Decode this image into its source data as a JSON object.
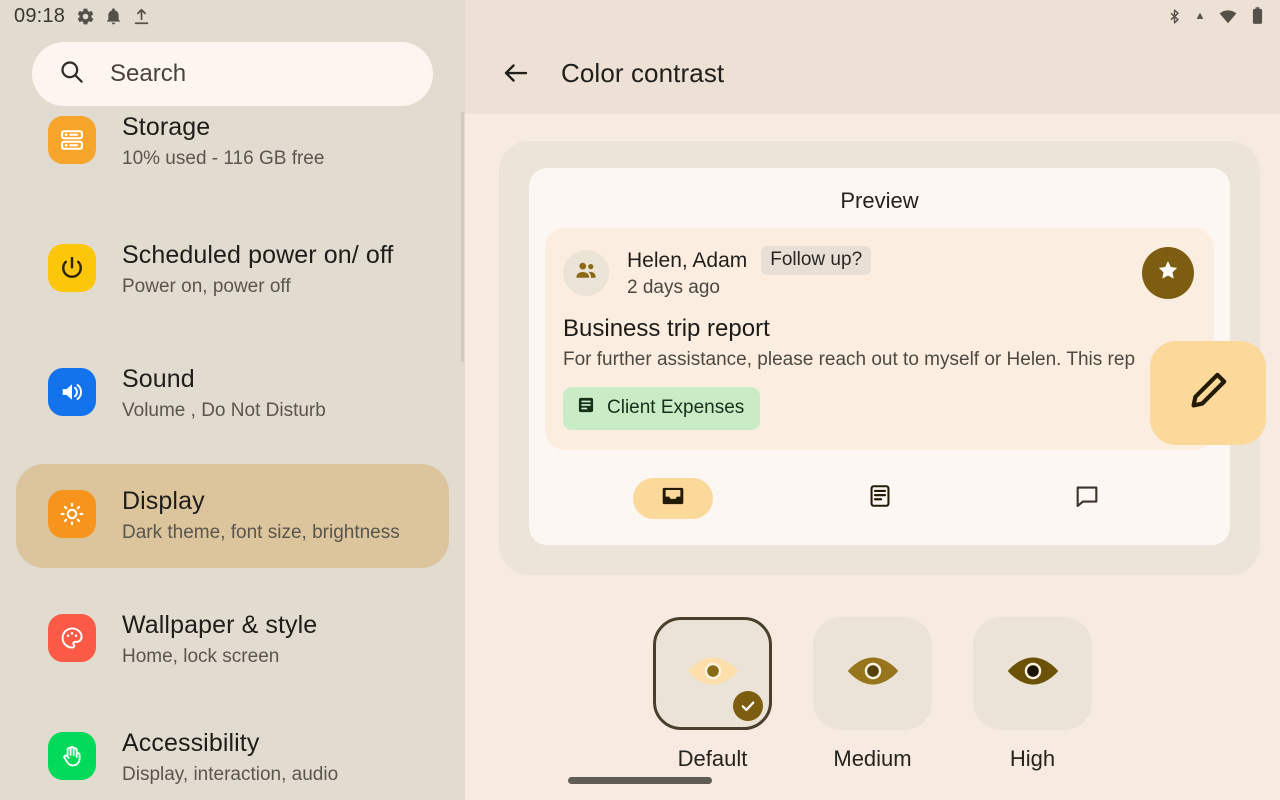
{
  "status_bar": {
    "time": "09:18",
    "left_icons": [
      "gear-icon",
      "notification-bell-icon",
      "upload-icon"
    ],
    "right_icons": [
      "bluetooth-icon",
      "signal-icon",
      "wifi-icon",
      "battery-icon"
    ]
  },
  "search": {
    "placeholder": "Search",
    "icon": "search-icon"
  },
  "sidebar": {
    "items": [
      {
        "title": "Storage",
        "subtitle": "10% used - 116 GB free",
        "icon": "storage-icon",
        "icon_color": "#f7a52b",
        "selected": false
      },
      {
        "title": "Scheduled power on/ off",
        "subtitle": "Power on, power off",
        "icon": "power-icon",
        "icon_color": "#fcc60b",
        "selected": false
      },
      {
        "title": "Sound",
        "subtitle": "Volume , Do Not Disturb",
        "icon": "sound-icon",
        "icon_color": "#1273ed",
        "selected": false
      },
      {
        "title": "Display",
        "subtitle": "Dark theme, font size, brightness",
        "icon": "brightness-icon",
        "icon_color": "#f7941d",
        "selected": true
      },
      {
        "title": "Wallpaper & style",
        "subtitle": "Home, lock screen",
        "icon": "palette-icon",
        "icon_color": "#fa5a46",
        "selected": false
      },
      {
        "title": "Accessibility",
        "subtitle": "Display, interaction, audio",
        "icon": "hand-icon",
        "icon_color": "#00d959",
        "selected": false
      }
    ]
  },
  "appbar": {
    "back_icon": "back-arrow-icon",
    "title": "Color contrast"
  },
  "preview": {
    "label": "Preview",
    "mail": {
      "avatar_icon": "group-people-icon",
      "sender": "Helen, Adam",
      "follow_up_chip": "Follow up?",
      "time": "2 days ago",
      "subject": "Business trip report",
      "snippet": "For further assistance, please reach out to myself or Helen. This rep",
      "label_chip": {
        "text": "Client Expenses",
        "icon": "article-icon",
        "color": "#c9ecc6"
      },
      "star_button_icon": "star-icon",
      "star_button_color": "#7d5e10",
      "edit_fab_icon": "pencil-edit-icon",
      "edit_fab_color": "#fbd99b"
    },
    "nav": [
      {
        "icon": "inbox-icon",
        "active": true
      },
      {
        "icon": "article-icon",
        "active": false
      },
      {
        "icon": "chat-bubble-icon",
        "active": false
      }
    ]
  },
  "contrast_options": [
    {
      "label": "Default",
      "icon": "eye-icon",
      "selected": true,
      "eye_color": "#fcdfab",
      "pupil_color": "#8a6a16"
    },
    {
      "label": "Medium",
      "icon": "eye-icon",
      "selected": false,
      "eye_color": "#96751c",
      "pupil_color": "#54400a"
    },
    {
      "label": "High",
      "icon": "eye-icon",
      "selected": false,
      "eye_color": "#6b5206",
      "pupil_color": "#1c1403"
    }
  ],
  "colors": {
    "sidebar_bg": "#e2dbd0",
    "panel_bg": "#f7ebe1",
    "appbar_bg": "#ece1d4",
    "selected_row": "#dcc59c",
    "preview_outer": "#ece4d9",
    "preview_card": "#fdf7f3",
    "mail_item": "#fbeee1",
    "accent": "#7d5e10"
  }
}
